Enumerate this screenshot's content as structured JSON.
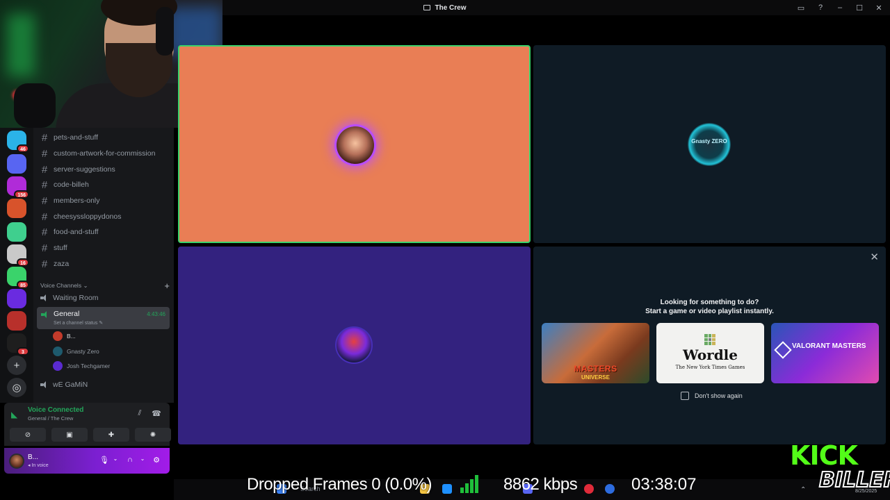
{
  "window": {
    "title": "The Crew"
  },
  "servers": [
    {
      "color": "#2bb3e8",
      "badge": "46"
    },
    {
      "color": "#5865f2",
      "badge": ""
    },
    {
      "color": "#b02bd8",
      "badge": "156"
    },
    {
      "color": "#d8532b",
      "badge": ""
    },
    {
      "color": "#3fcf8e",
      "badge": ""
    },
    {
      "color": "#c9c9c9",
      "badge": "16"
    },
    {
      "color": "#3ad36b",
      "badge": "85"
    },
    {
      "color": "#6a2be0",
      "badge": ""
    },
    {
      "color": "#b8302b",
      "badge": ""
    },
    {
      "color": "#1e1e1e",
      "badge": "3"
    }
  ],
  "channels": [
    "pets-and-stuff",
    "custom-artwork-for-commission",
    "server-suggestions",
    "code-billeh",
    "members-only",
    "cheesyssloppydonos",
    "food-and-stuff",
    "stuff",
    "zaza"
  ],
  "voice_category": "Voice Channels",
  "voice_channels": {
    "waiting": "Waiting Room",
    "general": {
      "name": "General",
      "status": "Set a channel status",
      "timer": "4:43:46"
    },
    "game": "wE GaMiN"
  },
  "members": [
    {
      "name": "B...",
      "color": "#c33b2b"
    },
    {
      "name": "Gnasty Zero",
      "color": "#1e5a6d"
    },
    {
      "name": "Josh Techgamer",
      "color": "#5a2bd0"
    }
  ],
  "voice_panel": {
    "title": "Voice Connected",
    "subtitle": "General / The Crew"
  },
  "user_panel": {
    "name": "B...",
    "status": "In voice"
  },
  "activity": {
    "line1": "Looking for something to do?",
    "line2": "Start a game or video playlist instantly.",
    "cards": {
      "motu": "MASTERS",
      "motu_sub": "UNIVERSE",
      "wordle": "Wordle",
      "wordle_sub": "The New York Times Games",
      "valorant": "VALORANT MASTERS"
    },
    "dont_show": "Don't show again"
  },
  "tiles": {
    "gnasty_label": "Gnasty ZERO"
  },
  "overlay": {
    "dropped": "Dropped Frames 0 (0.0%)",
    "kbps": "8862 kbps",
    "time": "03:38:07",
    "search": "Search",
    "date": "8/25/2025"
  },
  "brand": {
    "kick": "KICK",
    "name": "BILLEH"
  },
  "colors": {
    "accent_green": "#23a55a",
    "kick_green": "#53fc18",
    "speaking_border": "#3ad36b"
  }
}
